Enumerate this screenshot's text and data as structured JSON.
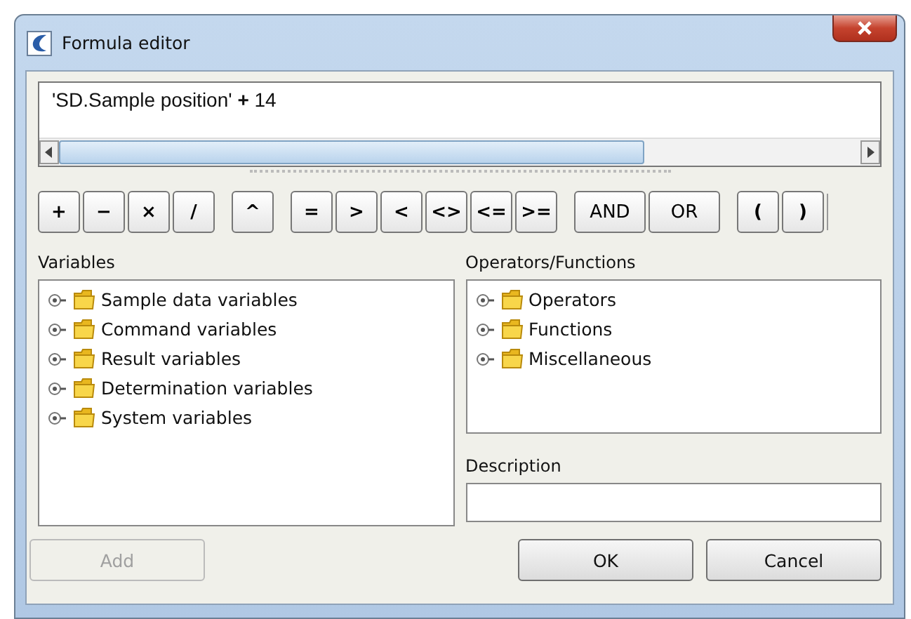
{
  "window": {
    "title": "Formula editor"
  },
  "formula": {
    "value": "'SD.Sample position' **+** 14"
  },
  "operator_groups": [
    {
      "kind": "symbol",
      "items": [
        "+",
        "−",
        "×",
        "/"
      ]
    },
    {
      "kind": "symbol",
      "items": [
        "^"
      ]
    },
    {
      "kind": "symbol",
      "items": [
        "=",
        ">",
        "<",
        "<>",
        "<=",
        ">="
      ]
    },
    {
      "kind": "word",
      "items": [
        "AND",
        "OR"
      ]
    },
    {
      "kind": "symbol",
      "items": [
        "(",
        ")"
      ]
    }
  ],
  "variables": {
    "label": "Variables",
    "items": [
      {
        "label": "Sample data variables",
        "expanded": false
      },
      {
        "label": "Command variables",
        "expanded": false
      },
      {
        "label": "Result variables",
        "expanded": false
      },
      {
        "label": "Determination variables",
        "expanded": false
      },
      {
        "label": "System variables",
        "expanded": false
      }
    ]
  },
  "operators_functions": {
    "label": "Operators/Functions",
    "items": [
      {
        "label": "Operators",
        "expanded": false
      },
      {
        "label": "Functions",
        "expanded": false
      },
      {
        "label": "Miscellaneous",
        "expanded": false
      }
    ]
  },
  "description": {
    "label": "Description"
  },
  "buttons": [
    {
      "label": "Add",
      "disabled": true
    },
    {
      "label": "OK",
      "disabled": false
    },
    {
      "label": "Cancel",
      "disabled": false
    }
  ]
}
